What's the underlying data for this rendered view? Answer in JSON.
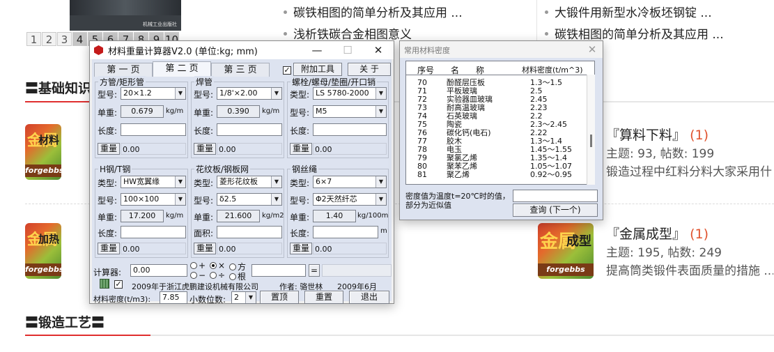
{
  "background": {
    "pager": [
      "1",
      "2",
      "3",
      "4",
      "5",
      "6",
      "7",
      "8",
      "9",
      "10"
    ],
    "pager_active": [
      "4",
      "5",
      "6",
      "7",
      "8",
      "9",
      "10"
    ],
    "book_publisher": "机械工业出版社",
    "links_col1": [
      "碳铁相图的简单分析及其应用 ...",
      "浅析铁碳合金相图意义"
    ],
    "links_col2": [
      "大锻件用新型水冷板坯钢锭 ...",
      "碳铁相图的简单分析及其应用 ..."
    ],
    "section1_title": "〓基础知识",
    "section2_title": "〓锻造工艺〓",
    "forums": [
      {
        "icon_char": "金属",
        "icon_word": "材料",
        "icon_brand": "forgebbs",
        "title": "『算料下料』",
        "count": "(1)",
        "stats": "主题: 93, 帖数: 199",
        "last": "锻造过程中红料分料大家采用什"
      },
      {
        "icon_char": "金属",
        "icon_word": "加热",
        "icon_brand": "forgebbs"
      },
      {
        "icon_char": "金属",
        "icon_word": "成型",
        "icon_brand": "forgebbs",
        "title": "『金属成型』",
        "count": "(1)",
        "stats": "主题: 195, 帖数: 249",
        "last": "提高筒类锻件表面质量的措施 ..."
      }
    ]
  },
  "calc_window": {
    "title": "材料重量计算器V2.0 (单位:kg; mm)",
    "minimize": "—",
    "maximize": "☐",
    "close": "✕",
    "tabs": [
      "第 一 页",
      "第 二 页",
      "第 三 页"
    ],
    "extra_tool_checked": "✓",
    "extra_tool_label": "附加工具",
    "about_label": "关 于",
    "groups": {
      "square_tube": {
        "title": "方管/矩形管",
        "model_label": "型号:",
        "model": "20×1.2",
        "unit_weight_label": "单重:",
        "unit_weight": "0.679",
        "unit": "kg/m",
        "length_label": "长度:",
        "weight_btn": "重量",
        "weight": "0.00"
      },
      "welded_pipe": {
        "title": "焊管",
        "model_label": "型号:",
        "model": "1/8'×2.00",
        "unit_weight_label": "单重:",
        "unit_weight": "0.390",
        "unit": "kg/m",
        "length_label": "长度:",
        "weight_btn": "重量",
        "weight": "0.00"
      },
      "bolt": {
        "title": "螺栓/螺母/垫圈/开口销",
        "type_label": "类型:",
        "type": "LS 5780-2000",
        "model_label": "型号:",
        "model": "M5",
        "length_label": "长度:",
        "weight_btn": "重量",
        "weight": "0.00"
      },
      "h_beam": {
        "title": "H钢/T钢",
        "type_label": "类型:",
        "type": "HW宽翼缘",
        "model_label": "型号:",
        "model": "100×100",
        "unit_weight_label": "单重:",
        "unit_weight": "17.200",
        "unit": "kg/m",
        "length_label": "长度:",
        "weight_btn": "重量",
        "weight": "0.00"
      },
      "checker_plate": {
        "title": "花纹板/钢板网",
        "type_label": "类型:",
        "type": "菱形花纹板",
        "model_label": "型号:",
        "model": "δ2.5",
        "unit_weight_label": "单重:",
        "unit_weight": "21.600",
        "unit": "kg/m2",
        "area_label": "面积:",
        "weight_btn": "重量",
        "weight": "0.00"
      },
      "wire_rope": {
        "title": "钢丝绳",
        "type_label": "类型:",
        "type": "6×7",
        "model_label": "型号:",
        "model": "Φ2天然纤芯",
        "unit_weight_label": "单重:",
        "unit_weight": "1.40",
        "unit": "kg/100m",
        "length_label": "长度:",
        "length_unit": "m",
        "weight_btn": "重量",
        "weight": "0.00"
      }
    },
    "calculator_label": "计算器:",
    "calculator_value": "0.00",
    "ops": [
      "+",
      "×",
      "方",
      "−",
      "÷",
      "根"
    ],
    "equals": "=",
    "company": "2009年于浙江虎鹏建设机械有限公司",
    "author": "作者: 骆世林",
    "date": "2009年6月",
    "density_label": "材料密度(t/m3):",
    "density_value": "7.85",
    "decimals_label": "小数位数:",
    "decimals_value": "2",
    "top_btn": "置顶",
    "reset_btn": "重置",
    "exit_btn": "退出"
  },
  "density_window": {
    "title": "常用材料密度",
    "close": "✕",
    "col_no": "序号",
    "col_name": "名　　称",
    "col_density": "材料密度(t/m^3)",
    "rows": [
      {
        "no": "70",
        "name": "酚醛层压板",
        "density": "1.3～1.5"
      },
      {
        "no": "71",
        "name": "平板玻璃",
        "density": "2.5"
      },
      {
        "no": "72",
        "name": "实验器皿玻璃",
        "density": "2.45"
      },
      {
        "no": "73",
        "name": "耐高温玻璃",
        "density": "2.23"
      },
      {
        "no": "74",
        "name": "石英玻璃",
        "density": "2.2"
      },
      {
        "no": "75",
        "name": "陶瓷",
        "density": " 2.3～2.45"
      },
      {
        "no": "76",
        "name": "碳化钙(电石)",
        "density": "2.22"
      },
      {
        "no": "77",
        "name": "胶木",
        "density": "1.3～1.4"
      },
      {
        "no": "78",
        "name": "电玉",
        "density": "1.45～1.55"
      },
      {
        "no": "79",
        "name": "聚氯乙烯",
        "density": "1.35～1.4"
      },
      {
        "no": "80",
        "name": "聚苯乙烯",
        "density": "1.05～1.07"
      },
      {
        "no": "81",
        "name": "聚乙烯",
        "density": "0.92～0.95"
      }
    ],
    "note": "密度值为温度t=20℃时的值，部分为近似值",
    "search_value": "",
    "search_btn": "查询 (下一个)"
  }
}
